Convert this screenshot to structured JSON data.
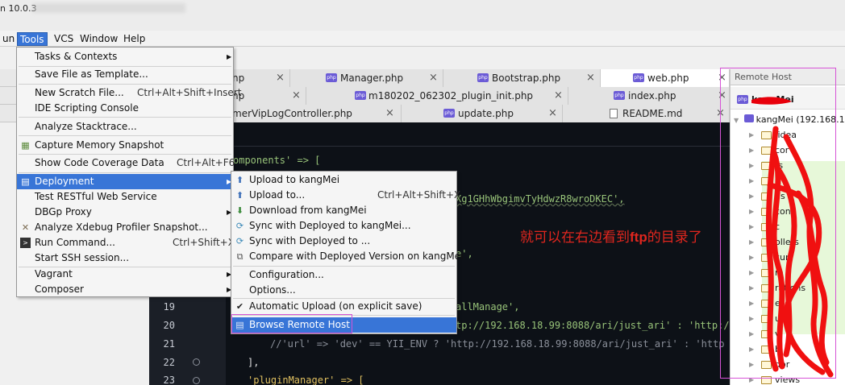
{
  "window": {
    "title_fragment": "n 10.0.3"
  },
  "menubar": {
    "items": [
      {
        "label": "un"
      },
      {
        "label": "Tools"
      },
      {
        "label": "VCS"
      },
      {
        "label": "Window"
      },
      {
        "label": "Help"
      }
    ]
  },
  "tabs": {
    "row1": [
      {
        "label": "np",
        "close": "×"
      },
      {
        "label": "Manager.php",
        "close": "×"
      },
      {
        "label": "Bootstrap.php",
        "close": "×"
      },
      {
        "label": "web.php",
        "close": "×"
      }
    ],
    "row2": [
      {
        "label": "np",
        "close": "×"
      },
      {
        "label": "m180202_062302_plugin_init.php",
        "close": "×"
      },
      {
        "label": "index.php",
        "close": "×"
      }
    ],
    "row3": [
      {
        "label": "merVipLogController.php",
        "close": "×"
      },
      {
        "label": "update.php",
        "close": "×"
      },
      {
        "label": "README.md",
        "close": "×"
      }
    ]
  },
  "tools_menu": {
    "items": [
      {
        "label": "Tasks & Contexts",
        "shortcut": "",
        "submenu": true
      },
      {
        "label": "Save File as Template...",
        "shortcut": "",
        "submenu": false
      },
      {
        "label": "New Scratch File...",
        "shortcut": "Ctrl+Alt+Shift+Insert",
        "submenu": false
      },
      {
        "label": "IDE Scripting Console",
        "shortcut": "",
        "submenu": false
      },
      {
        "label": "Analyze Stacktrace...",
        "shortcut": "",
        "submenu": false
      },
      {
        "label": "Capture Memory Snapshot",
        "shortcut": "",
        "submenu": false
      },
      {
        "label": "Show Code Coverage Data",
        "shortcut": "Ctrl+Alt+F6",
        "submenu": false
      },
      {
        "label": "Deployment",
        "shortcut": "",
        "submenu": true
      },
      {
        "label": "Test RESTful Web Service",
        "shortcut": "",
        "submenu": false
      },
      {
        "label": "DBGp Proxy",
        "shortcut": "",
        "submenu": true
      },
      {
        "label": "Analyze Xdebug Profiler Snapshot...",
        "shortcut": "",
        "submenu": false
      },
      {
        "label": "Run Command...",
        "shortcut": "Ctrl+Shift+X",
        "submenu": false
      },
      {
        "label": "Start SSH session...",
        "shortcut": "",
        "submenu": false
      },
      {
        "label": "Vagrant",
        "shortcut": "",
        "submenu": true
      },
      {
        "label": "Composer",
        "shortcut": "",
        "submenu": true
      }
    ]
  },
  "deployment_menu": {
    "items": [
      {
        "label": "Upload to kangMei",
        "shortcut": ""
      },
      {
        "label": "Upload to...",
        "shortcut": "Ctrl+Alt+Shift+X"
      },
      {
        "label": "Download from kangMei",
        "shortcut": ""
      },
      {
        "label": "Sync with Deployed to kangMei...",
        "shortcut": ""
      },
      {
        "label": "Sync with Deployed to ...",
        "shortcut": ""
      },
      {
        "label": "Compare with Deployed Version on kangMei",
        "shortcut": ""
      },
      {
        "label": "Configuration...",
        "shortcut": ""
      },
      {
        "label": "Options...",
        "shortcut": ""
      },
      {
        "label": "Automatic Upload (on explicit save)",
        "shortcut": ""
      },
      {
        "label": "Browse Remote Host",
        "shortcut": ""
      }
    ]
  },
  "editor": {
    "fragments": {
      "components": "omponents' => [",
      "key_tail": "Xg1GHhWbgimvTyHdwzR8wroDKEC',",
      "frag_e": "e',",
      "frag_all": "allManage',",
      "frag_url1": "tp://192.168.18.99:8088/ari/just_ari' : 'http:/",
      "line21": "//'url' => 'dev' == YII_ENV ? 'http://192.168.18.99:8088/ari/just_ari' : 'http",
      "line22": "],",
      "line23": "'pluginManager' => ["
    },
    "line_numbers": [
      "19",
      "20",
      "21",
      "22",
      "23"
    ]
  },
  "remote_host": {
    "title": "Remote Host",
    "server": "kangMei",
    "root": "kangMei (192.168.1",
    "items": [
      ".idea",
      "cor",
      "ts",
      "ds",
      "con",
      "c",
      "ollers",
      "cur",
      "m",
      "rations",
      "e",
      "u",
      "v",
      "b",
      "dor",
      "views"
    ]
  },
  "annotation": {
    "text_before": "就可以在右边看到",
    "text_bold": "ftp",
    "text_after": "的目录了"
  },
  "colors": {
    "menu_highlight": "#3875d7",
    "annotation_red": "#e0261e",
    "box_magenta": "#d653d6"
  }
}
